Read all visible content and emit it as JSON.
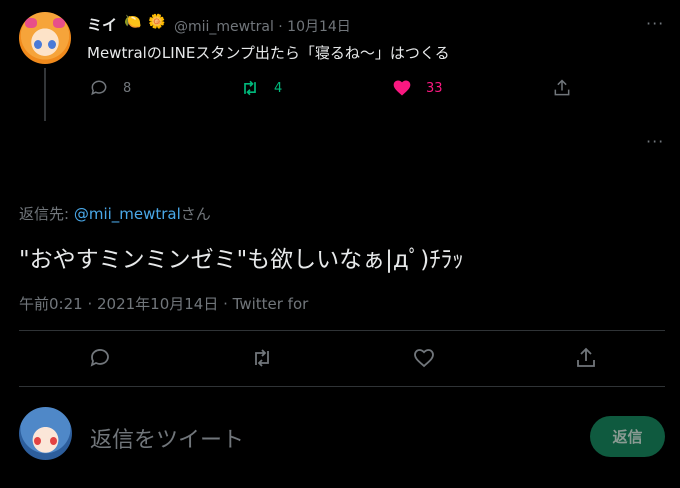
{
  "parent_tweet": {
    "author_name": "ミイ",
    "emoji_1": "🍋",
    "emoji_2": "🌼",
    "handle_time": "@mii_mewtral · 10月14日",
    "text": "MewtralのLINEスタンプ出たら「寝るね〜」はつくる",
    "more": "···",
    "reply_count": "8",
    "retweet_count": "4",
    "like_count": "33",
    "colors": {
      "retweet": "#00ba7c",
      "like": "#f91880"
    }
  },
  "main_tweet": {
    "more": "···",
    "reply_to_label": "返信先: ",
    "reply_to_mention": "@mii_mewtral",
    "reply_to_suffix": "さん",
    "text": "\"おやすミンミンゼミ\"も欲しいなぁ|дﾟ)ﾁﾗｯ",
    "meta": "午前0:21 · 2021年10月14日 · Twitter for"
  },
  "composer": {
    "placeholder": "返信をツイート",
    "reply_button": "返信"
  }
}
